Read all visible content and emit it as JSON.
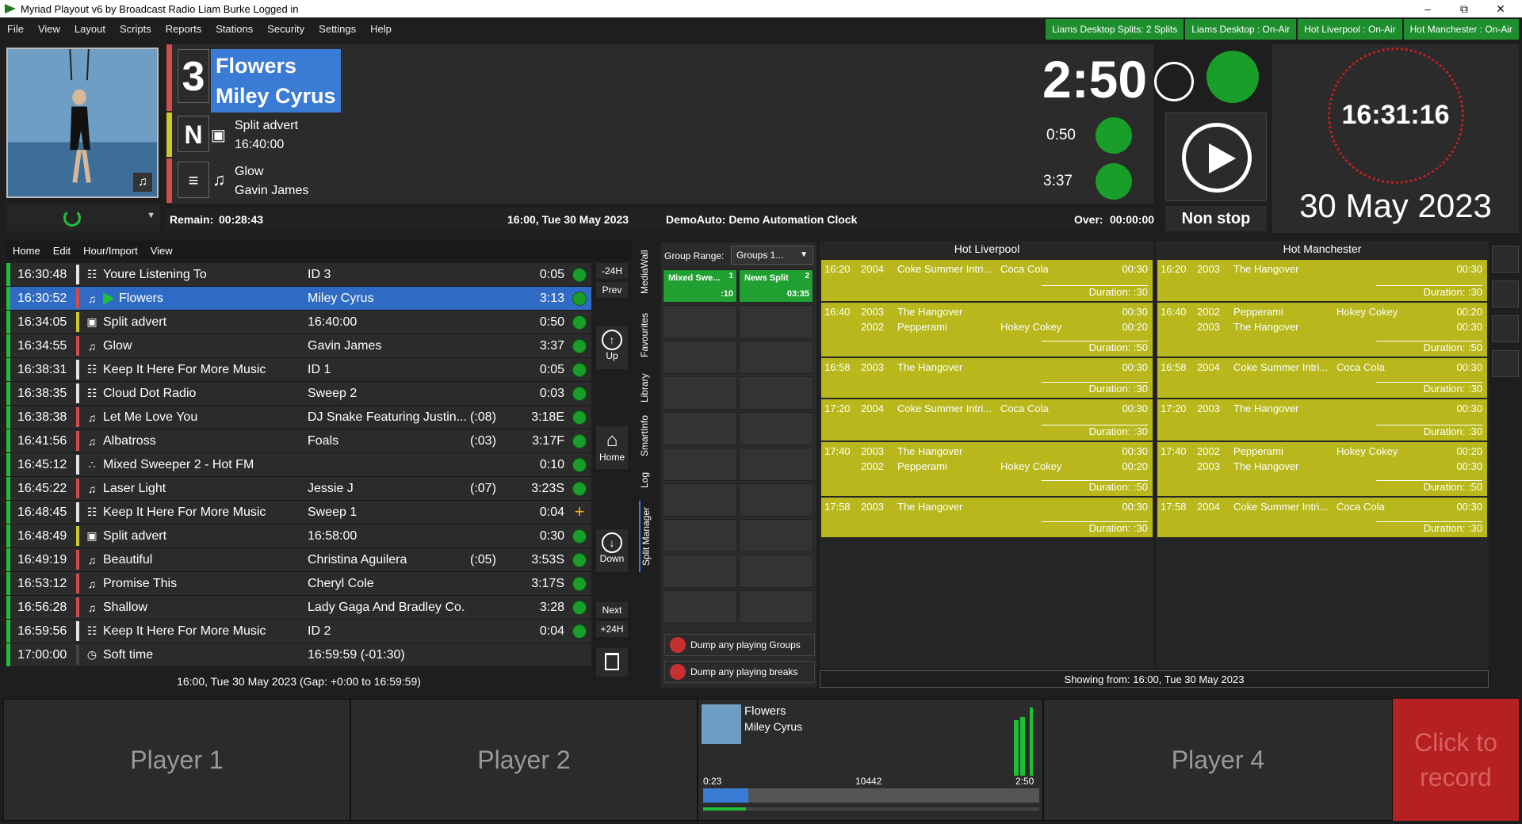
{
  "window": {
    "title": "Myriad Playout v6 by Broadcast Radio Liam Burke Logged in",
    "controls": [
      "minimize",
      "restore",
      "close"
    ]
  },
  "menu": [
    "File",
    "View",
    "Layout",
    "Scripts",
    "Reports",
    "Stations",
    "Security",
    "Settings",
    "Help"
  ],
  "status_buttons": [
    {
      "label": "Liams Desktop Splits: 2 Splits"
    },
    {
      "label": "Liams Desktop : On-Air"
    },
    {
      "label": "Hot Liverpool : On-Air"
    },
    {
      "label": "Hot Manchester : On-Air"
    }
  ],
  "now_playing": {
    "number": "3",
    "title": "Flowers",
    "artist": "Miley Cyrus",
    "countdown": "2:50",
    "next_marker": "N",
    "next_item": {
      "title": "Split advert",
      "sub": "16:40:00",
      "duration": "0:50"
    },
    "after_item": {
      "title": "Glow",
      "sub": "Gavin James",
      "duration": "3:37"
    },
    "remain_label": "Remain:",
    "remain_value": "00:28:43",
    "clock_text": "16:00, Tue 30 May 2023",
    "automation": "DemoAuto: Demo Automation Clock",
    "over_label": "Over:",
    "over_value": "00:00:00",
    "mode": "Non stop"
  },
  "clock": {
    "time": "16:31:16",
    "date": "30 May 2023"
  },
  "log_menu": [
    "Home",
    "Edit",
    "Hour/Import",
    "View"
  ],
  "log_rows": [
    {
      "time": "16:30:48",
      "icon": "antenna-icon",
      "title": "Youre Listening To",
      "artist": "ID 3",
      "pad": "",
      "dur": "0:05",
      "status": "played"
    },
    {
      "time": "16:30:52",
      "icon": "music-icon",
      "title": "Flowers",
      "artist": "Miley Cyrus",
      "pad": "",
      "dur": "3:13",
      "status": "playing"
    },
    {
      "time": "16:34:05",
      "icon": "advert-icon",
      "title": "Split advert",
      "artist": "16:40:00",
      "pad": "",
      "dur": "0:50",
      "status": "ready"
    },
    {
      "time": "16:34:55",
      "icon": "music-icon",
      "title": "Glow",
      "artist": "Gavin James",
      "pad": "",
      "dur": "3:37",
      "status": "ready"
    },
    {
      "time": "16:38:31",
      "icon": "antenna-icon",
      "title": "Keep It Here For More Music",
      "artist": "ID 1",
      "pad": "",
      "dur": "0:05",
      "status": "ready"
    },
    {
      "time": "16:38:35",
      "icon": "antenna-icon",
      "title": "Cloud Dot Radio",
      "artist": "Sweep 2",
      "pad": "",
      "dur": "0:03",
      "status": "ready"
    },
    {
      "time": "16:38:38",
      "icon": "music-icon",
      "title": "Let Me Love You",
      "artist": "DJ Snake Featuring Justin...",
      "pad": "(:08)",
      "dur": "3:18E",
      "status": "ready"
    },
    {
      "time": "16:41:56",
      "icon": "music-icon",
      "title": "Albatross",
      "artist": "Foals",
      "pad": "(:03)",
      "dur": "3:17F",
      "status": "ready"
    },
    {
      "time": "16:45:12",
      "icon": "mixed-icon",
      "title": "Mixed Sweeper 2 - Hot FM",
      "artist": "",
      "pad": "",
      "dur": "0:10",
      "status": "ready"
    },
    {
      "time": "16:45:22",
      "icon": "music-icon",
      "title": "Laser Light",
      "artist": "Jessie J",
      "pad": "(:07)",
      "dur": "3:23S",
      "status": "ready"
    },
    {
      "time": "16:48:45",
      "icon": "antenna-icon",
      "title": "Keep It Here For More Music",
      "artist": "Sweep 1",
      "pad": "",
      "dur": "0:04",
      "status": "plus"
    },
    {
      "time": "16:48:49",
      "icon": "advert-icon",
      "title": "Split advert",
      "artist": "16:58:00",
      "pad": "",
      "dur": "0:30",
      "status": "ready"
    },
    {
      "time": "16:49:19",
      "icon": "music-icon",
      "title": "Beautiful",
      "artist": "Christina Aguilera",
      "pad": "(:05)",
      "dur": "3:53S",
      "status": "ready"
    },
    {
      "time": "16:53:12",
      "icon": "music-icon",
      "title": "Promise This",
      "artist": "Cheryl Cole",
      "pad": "",
      "dur": "3:17S",
      "status": "ready"
    },
    {
      "time": "16:56:28",
      "icon": "music-icon",
      "title": "Shallow",
      "artist": "Lady Gaga And Bradley Co...",
      "pad": "",
      "dur": "3:28",
      "status": "ready"
    },
    {
      "time": "16:59:56",
      "icon": "antenna-icon",
      "title": "Keep It Here For More Music",
      "artist": "ID 2",
      "pad": "",
      "dur": "0:04",
      "status": "ready"
    },
    {
      "time": "17:00:00",
      "icon": "soft-time-icon",
      "title": "Soft time",
      "artist": "16:59:59 (-01:30)",
      "pad": "",
      "dur": "",
      "status": "none"
    }
  ],
  "log_footer": "16:00, Tue 30 May 2023 (Gap: +0:00 to 16:59:59)",
  "log_nav": {
    "minus24": "-24H",
    "prev": "Prev",
    "up": "Up",
    "home": "Home",
    "down": "Down",
    "next": "Next",
    "plus24": "+24H"
  },
  "side_tabs": [
    "MediaWall",
    "Favourites",
    "Library",
    "SmartInfo",
    "Log",
    "Split Manager"
  ],
  "split": {
    "group_range_label": "Group Range:",
    "group_range_value": "Groups 1...",
    "cells": [
      {
        "name": "Mixed Swe...",
        "num": "1",
        "time": ":10"
      },
      {
        "name": "News Split",
        "num": "2",
        "time": "03:35"
      }
    ],
    "dump_groups": "Dump any playing Groups",
    "dump_breaks": "Dump any playing breaks"
  },
  "stations": [
    {
      "name": "Hot Liverpool",
      "breaks": [
        {
          "lines": [
            {
              "t": "16:20",
              "y": "2004",
              "a": "Coke Summer Intri...",
              "b": "Coca Cola",
              "d": "00:30"
            }
          ],
          "duration": "Duration:  :30"
        },
        {
          "lines": [
            {
              "t": "16:40",
              "y": "2003",
              "a": "The Hangover",
              "b": "",
              "d": "00:30"
            },
            {
              "t": "",
              "y": "2002",
              "a": "Pepperami",
              "b": "Hokey Cokey",
              "d": "00:20"
            }
          ],
          "duration": "Duration:  :50"
        },
        {
          "lines": [
            {
              "t": "16:58",
              "y": "2003",
              "a": "The Hangover",
              "b": "",
              "d": "00:30"
            }
          ],
          "duration": "Duration:  :30"
        },
        {
          "lines": [
            {
              "t": "17:20",
              "y": "2004",
              "a": "Coke Summer Intri...",
              "b": "Coca Cola",
              "d": "00:30"
            }
          ],
          "duration": "Duration:  :30"
        },
        {
          "lines": [
            {
              "t": "17:40",
              "y": "2003",
              "a": "The Hangover",
              "b": "",
              "d": "00:30"
            },
            {
              "t": "",
              "y": "2002",
              "a": "Pepperami",
              "b": "Hokey Cokey",
              "d": "00:20"
            }
          ],
          "duration": "Duration:  :50"
        },
        {
          "lines": [
            {
              "t": "17:58",
              "y": "2003",
              "a": "The Hangover",
              "b": "",
              "d": "00:30"
            }
          ],
          "duration": "Duration:  :30"
        }
      ]
    },
    {
      "name": "Hot Manchester",
      "breaks": [
        {
          "lines": [
            {
              "t": "16:20",
              "y": "2003",
              "a": "The Hangover",
              "b": "",
              "d": "00:30"
            }
          ],
          "duration": "Duration:  :30"
        },
        {
          "lines": [
            {
              "t": "16:40",
              "y": "2002",
              "a": "Pepperami",
              "b": "Hokey Cokey",
              "d": "00:20"
            },
            {
              "t": "",
              "y": "2003",
              "a": "The Hangover",
              "b": "",
              "d": "00:30"
            }
          ],
          "duration": "Duration:  :50"
        },
        {
          "lines": [
            {
              "t": "16:58",
              "y": "2004",
              "a": "Coke Summer Intri...",
              "b": "Coca Cola",
              "d": "00:30"
            }
          ],
          "duration": "Duration:  :30"
        },
        {
          "lines": [
            {
              "t": "17:20",
              "y": "2003",
              "a": "The Hangover",
              "b": "",
              "d": "00:30"
            }
          ],
          "duration": "Duration:  :30"
        },
        {
          "lines": [
            {
              "t": "17:40",
              "y": "2002",
              "a": "Pepperami",
              "b": "Hokey Cokey",
              "d": "00:20"
            },
            {
              "t": "",
              "y": "2003",
              "a": "The Hangover",
              "b": "",
              "d": "00:30"
            }
          ],
          "duration": "Duration:  :50"
        },
        {
          "lines": [
            {
              "t": "17:58",
              "y": "2004",
              "a": "Coke Summer Intri...",
              "b": "Coca Cola",
              "d": "00:30"
            }
          ],
          "duration": "Duration:  :30"
        }
      ]
    }
  ],
  "showing_from": "Showing from: 16:00, Tue 30 May 2023",
  "players": {
    "p1": "Player 1",
    "p2": "Player 2",
    "p4": "Player 4",
    "p3": {
      "title": "Flowers",
      "artist": "Miley Cyrus",
      "elapsed": "0:23",
      "mid": "10442",
      "total": "2:50",
      "progress": 0.135
    },
    "record": "Click to record"
  },
  "colors": {
    "green": "#1a9e2a",
    "accent_blue": "#2f6bc4",
    "break_yellow": "#b8b81c",
    "record_red": "#b52020"
  }
}
